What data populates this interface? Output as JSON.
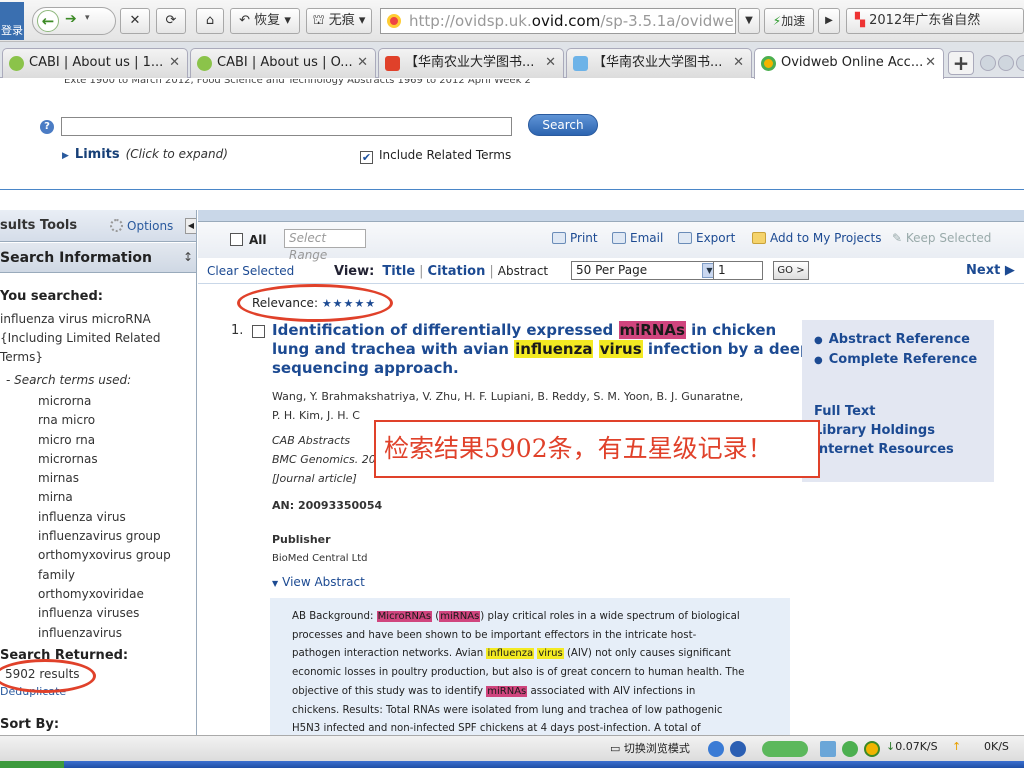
{
  "browser": {
    "login_label": "登录",
    "restore_label": "恢复",
    "incognito_label": "无痕",
    "url_prefix": "http://ovidsp.uk.",
    "url_domain": "ovid.com",
    "url_suffix": "/sp-3.5.1a/ovidweb.cg",
    "accelerate_label": "加速",
    "news_label": "2012年广东省自然"
  },
  "tabs": [
    {
      "label": "CABI | About us | 1...",
      "icon": "cabi-icon",
      "active": false
    },
    {
      "label": "CABI | About us | O...",
      "icon": "cabi-icon",
      "active": false
    },
    {
      "label": "【华南农业大学图书...",
      "icon": "library-icon",
      "active": false
    },
    {
      "label": "【华南农业大学图书...",
      "icon": "page-icon",
      "active": false
    },
    {
      "label": "Ovidweb Online Acc...",
      "icon": "ovid-icon",
      "active": true
    }
  ],
  "search_panel": {
    "cutoff_text": "Exte 1900 to March 2012, Food Science and Technology Abstracts 1969 to 2012 April Week 2",
    "search_value": "",
    "search_button": "Search",
    "limits_label": "Limits",
    "limits_hint": "(Click to expand)",
    "include_related": "Include Related Terms",
    "include_related_checked": true
  },
  "sidebar": {
    "results_tools": "sults Tools",
    "options": "Options",
    "search_information": "Search Information",
    "you_searched_label": "You searched:",
    "query_lines": [
      "influenza virus microRNA",
      "{Including Limited Related",
      "Terms}"
    ],
    "terms_used_label": "-  Search terms used:",
    "terms": [
      "microrna",
      "rna micro",
      "micro rna",
      "micrornas",
      "mirnas",
      "mirna",
      "influenza virus",
      "influenzavirus group",
      "orthomyxovirus group",
      "family",
      "orthomyxoviridae",
      "influenza viruses",
      "influenzavirus"
    ],
    "search_returned_label": "Search Returned:",
    "results_count": "5902 results",
    "deduplicate": "Deduplicate",
    "sort_by_label": "Sort By:"
  },
  "results_toolbar": {
    "all_label": "All",
    "range_placeholder": "Select Range",
    "print": "Print",
    "email": "Email",
    "export": "Export",
    "add_to_projects": "Add to My Projects",
    "keep_selected": "Keep Selected",
    "clear_selected": "Clear Selected",
    "view_label": "View:",
    "view_title": "Title",
    "view_citation": "Citation",
    "view_abstract": "Abstract",
    "per_page": "50 Per Page",
    "page_number": "1",
    "go": "GO >",
    "next": "Next ▶"
  },
  "record": {
    "relevance_label": "Relevance:",
    "relevance_stars": 5,
    "relevance_text": "★★★★★",
    "number": "1.",
    "title_parts": [
      "Identification of differentially expressed ",
      "miRNAs",
      " in chicken lung and trachea with avian ",
      "influenza",
      " ",
      "virus",
      " infection by a deep sequencing approach."
    ],
    "authors_1": "Wang, Y. Brahmakshatriya, V. Zhu, H. F. Lupiani, B. Reddy, S. M. Yoon, B. J. Gunaratne,",
    "authors_2": "P. H. Kim, J. H. C",
    "database": "CAB Abstracts",
    "journal": "BMC Genomics. 20",
    "type": "[Journal article]",
    "an": "AN: 20093350054",
    "publisher_label": "Publisher",
    "publisher": "BioMed Central Ltd",
    "view_abstract": "View Abstract",
    "abstract_lines": [
      [
        "AB Background: ",
        "MicroRNAs",
        " (",
        "miRNAs",
        ") play critical roles in a wide spectrum of biological"
      ],
      [
        "processes and have been shown to be important effectors in the intricate host-"
      ],
      [
        "pathogen interaction networks. Avian ",
        "influenza",
        " ",
        "virus",
        " (AIV) not only causes significant"
      ],
      [
        "economic losses in poultry production, but also is of great concern to human health. The"
      ],
      [
        "objective of this study was to identify ",
        "miRNAs",
        " associated with AIV infections in"
      ],
      [
        "chickens. Results: Total RNAs were isolated from lung and trachea of low pathogenic"
      ],
      [
        "H5N3 infected and non-infected SPF chickens at 4 days post-infection. A total of"
      ]
    ],
    "links": [
      "Abstract Reference",
      "Complete Reference",
      "Full Text",
      "Library Holdings",
      "Internet Resources"
    ]
  },
  "annotation": "检索结果5902条，有五星级记录！",
  "status_bar": {
    "browse_mode": "切换浏览模式",
    "download_speed": "0.07K/S",
    "upload_speed": "0K/S"
  },
  "colors": {
    "link_blue": "#1c4a92",
    "highlight_magenta": "#d0457e",
    "highlight_yellow": "#f3ea22",
    "annotation_red": "#e0412a"
  }
}
